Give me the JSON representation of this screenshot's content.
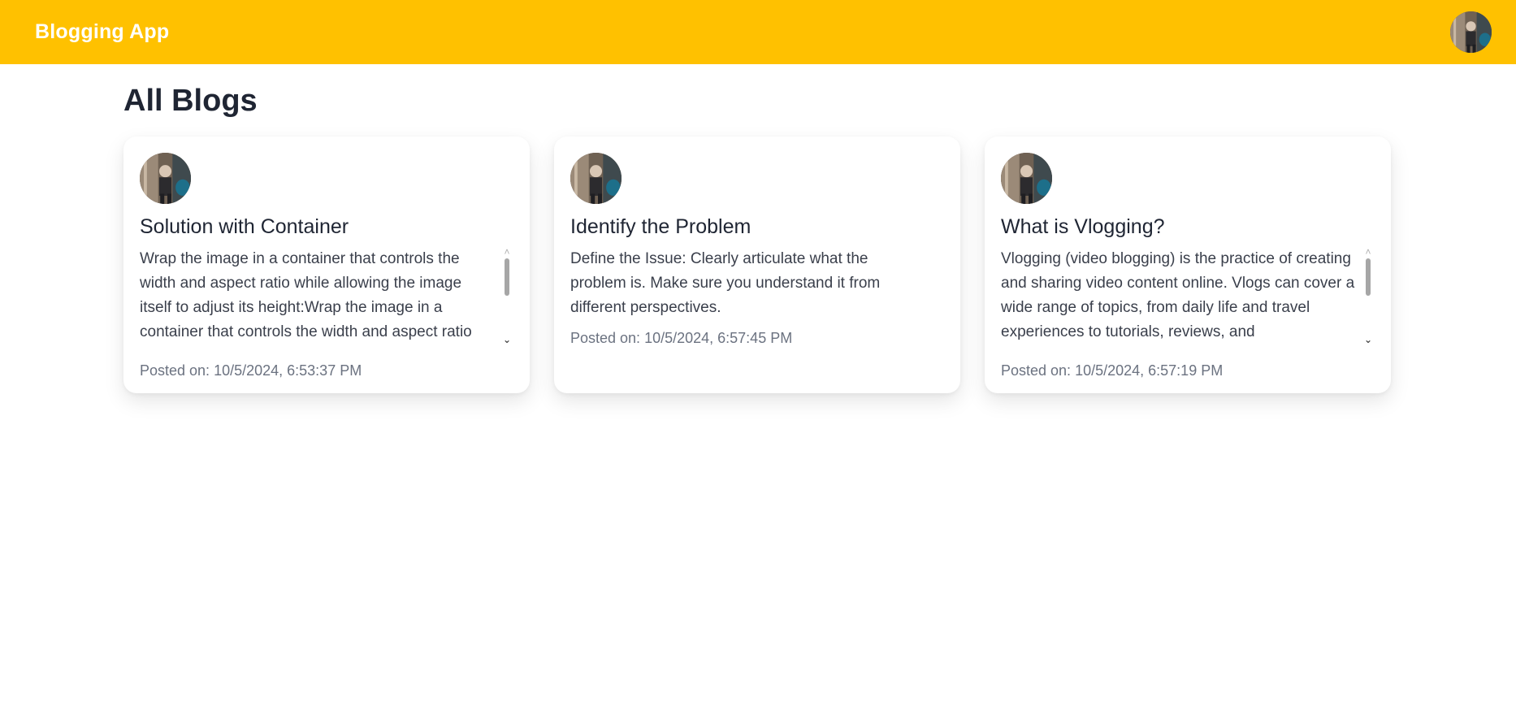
{
  "app": {
    "brand": "Blogging App",
    "accent_color": "#ffc100"
  },
  "header": {
    "avatar_icon": "user-avatar"
  },
  "main": {
    "title": "All Blogs",
    "cards": [
      {
        "title": "Solution with Container",
        "body": "Wrap the image in a container that controls the width and aspect ratio while allowing the image itself to adjust its height:Wrap the image in a container that controls the width and aspect ratio",
        "posted": "Posted on: 10/5/2024, 6:53:37 PM"
      },
      {
        "title": "Identify the Problem",
        "body": "Define the Issue: Clearly articulate what the problem is. Make sure you understand it from different perspectives.",
        "posted": "Posted on: 10/5/2024, 6:57:45 PM"
      },
      {
        "title": "What is Vlogging?",
        "body": "Vlogging (video blogging) is the practice of creating and sharing video content online. Vlogs can cover a wide range of topics, from daily life and travel experiences to tutorials, reviews, and",
        "posted": "Posted on: 10/5/2024, 6:57:19 PM"
      }
    ],
    "scroll_up_glyph": "˄",
    "scroll_down_glyph": "⌄"
  }
}
